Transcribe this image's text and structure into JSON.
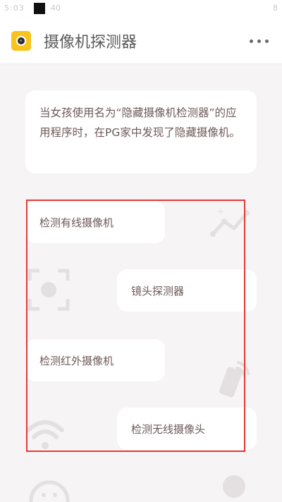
{
  "status_bar": {
    "left_text": "5:03",
    "mid_text": "40",
    "right_text": "8"
  },
  "header": {
    "title": "摄像机探测器",
    "more_icon": "more-horizontal-icon",
    "app_icon": "camera-app-icon"
  },
  "description": {
    "text": "当女孩使用名为“隐藏摄像机检测器”的应用程序时，在PG家中发现了隐藏摄像机。"
  },
  "features": [
    {
      "label": "检测有线摄像机"
    },
    {
      "label": "镜头探测器"
    },
    {
      "label": "检测红外摄像机"
    },
    {
      "label": "检测无线摄像头"
    }
  ],
  "colors": {
    "background": "#f6f4f5",
    "card": "#ffffff",
    "text": "#6d5a58",
    "accent_yellow": "#f7c31c",
    "selection_red": "#e53935"
  }
}
